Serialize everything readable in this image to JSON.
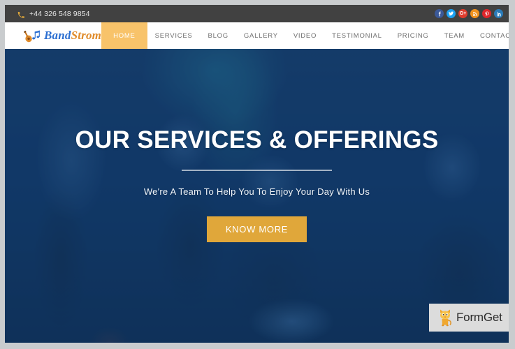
{
  "topbar": {
    "phone_icon": "phone-icon",
    "phone": "+44 326 548 9854",
    "social": [
      {
        "name": "facebook",
        "glyph": "f",
        "color": "#3b5998"
      },
      {
        "name": "twitter",
        "glyph": "t",
        "color": "#1da1f2"
      },
      {
        "name": "google-plus",
        "glyph": "G+",
        "color": "#e03c2d"
      },
      {
        "name": "rss",
        "glyph": "r",
        "color": "#f0921e"
      },
      {
        "name": "pinterest",
        "glyph": "P",
        "color": "#e1252a"
      },
      {
        "name": "linkedin",
        "glyph": "in",
        "color": "#2a7bb9"
      }
    ]
  },
  "header": {
    "logo_icon": "guitar-music-note-icon",
    "logo_primary": "Band",
    "logo_secondary": "Strom",
    "nav": [
      {
        "label": "HOME",
        "active": true
      },
      {
        "label": "SERVICES",
        "active": false
      },
      {
        "label": "BLOG",
        "active": false
      },
      {
        "label": "GALLERY",
        "active": false
      },
      {
        "label": "VIDEO",
        "active": false
      },
      {
        "label": "TESTIMONIAL",
        "active": false
      },
      {
        "label": "PRICING",
        "active": false
      },
      {
        "label": "TEAM",
        "active": false
      },
      {
        "label": "CONTACT",
        "active": false
      }
    ]
  },
  "hero": {
    "title": "OUR SERVICES & OFFERINGS",
    "subtitle": "We're A Team To Help You To Enjoy Your Day With Us",
    "cta_label": "KNOW MORE",
    "overlay_color": "#1b5693",
    "accent_color": "#e0a73a"
  },
  "watermark": {
    "icon": "formget-cat-mascot-icon",
    "label": "FormGet"
  }
}
